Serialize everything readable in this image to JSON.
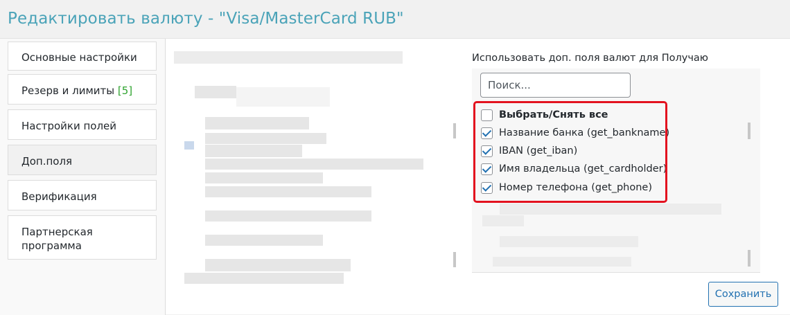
{
  "page": {
    "title": "Редактировать валюту - \"Visa/MasterCard RUB\""
  },
  "sidebar": {
    "tabs": [
      {
        "label": "Основные настройки",
        "badge": ""
      },
      {
        "label": "Резерв и лимиты ",
        "badge": "[5]"
      },
      {
        "label": "Настройки полей",
        "badge": ""
      },
      {
        "label": "Доп.поля",
        "badge": ""
      },
      {
        "label": "Верификация",
        "badge": ""
      },
      {
        "label": "Партнерская программа",
        "badge": ""
      }
    ]
  },
  "fields": {
    "label": "Использовать доп. поля валют для Получаю",
    "search_placeholder": "Поиск...",
    "select_all": "Выбрать/Снять все",
    "options": [
      {
        "label": "Название банка (get_bankname)",
        "checked": true
      },
      {
        "label": "IBAN (get_iban)",
        "checked": true
      },
      {
        "label": "Имя владельца (get_cardholder)",
        "checked": true
      },
      {
        "label": "Номер телефона (get_phone)",
        "checked": true
      }
    ]
  },
  "actions": {
    "save_label": "Сохранить"
  }
}
